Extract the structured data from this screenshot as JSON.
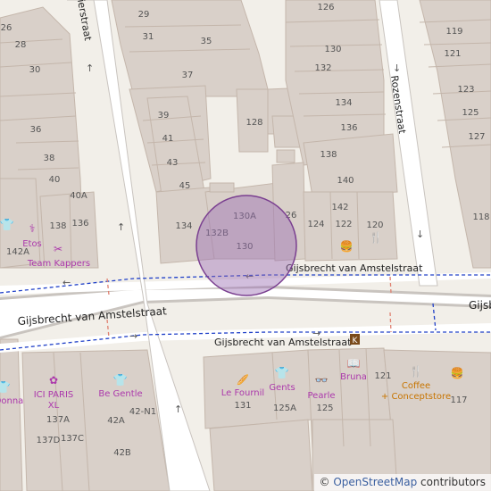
{
  "map": {
    "streets": {
      "gijsbrecht_upper": "Gijsbrecht van Amstelstraat",
      "gijsbrecht_left": "Gijsbrecht van Amstelstraat",
      "gijsbrecht_lower": "Gijsbrecht van Amstelstraat",
      "gijsbrecht_right": "Gijsb",
      "rozenstraat": "Rozenstraat",
      "top_left_street": "ierstraat"
    },
    "house_numbers": [
      "29",
      "126",
      "119",
      "26",
      "31",
      "35",
      "28",
      "121",
      "130",
      "30",
      "37",
      "132",
      "123",
      "134",
      "125",
      "128",
      "36",
      "39",
      "38",
      "136",
      "41",
      "127",
      "43",
      "138",
      "140",
      "40",
      "40A",
      "45",
      "142",
      "26",
      "124",
      "118",
      "134",
      "130A",
      "132B",
      "136",
      "138",
      "130",
      "122",
      "120",
      "142A",
      "131",
      "137A",
      "42A",
      "42-N1",
      "125A",
      "125",
      "137D",
      "137C",
      "42B",
      "117",
      "121"
    ],
    "pois": {
      "etos": "Etos",
      "team_kappers": "Team Kappers",
      "ici_paris": [
        "ICI PARIS",
        "XL"
      ],
      "be_gentle": "Be Gentle",
      "le_fournil": "Le Fournil",
      "gents": "Gents",
      "pearle": "Pearle",
      "bruna": "Bruna",
      "coffee": [
        "Coffee",
        "+ Conceptstore"
      ],
      "donna": "Donna"
    },
    "marker": {
      "shape": "circle",
      "fill": "#9c6fb3",
      "opacity": 0.45
    }
  },
  "attribution": {
    "copyright": "©",
    "link": "OpenStreetMap",
    "suffix": " contributors"
  },
  "colors": {
    "background": "#f2efe9",
    "building": "#d9d0c9",
    "building_stroke": "#c4b6ab",
    "road": "#ffffff",
    "road_casing": "#c9c4bf",
    "bus_route": "#2040c8",
    "poi_purple": "#ac39ac",
    "poi_orange": "#c77400"
  }
}
